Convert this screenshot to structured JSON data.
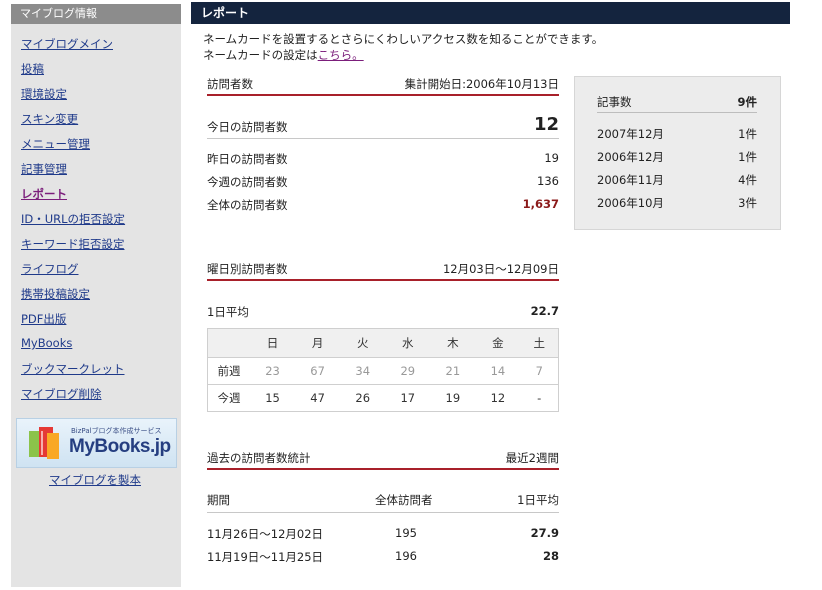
{
  "sidebar": {
    "title": "マイブログ情報",
    "items": [
      {
        "label": "マイブログメイン",
        "active": false
      },
      {
        "label": "投稿",
        "active": false
      },
      {
        "label": "環境設定",
        "active": false
      },
      {
        "label": "スキン変更",
        "active": false
      },
      {
        "label": "メニュー管理",
        "active": false
      },
      {
        "label": "記事管理",
        "active": false
      },
      {
        "label": "レポート",
        "active": true
      },
      {
        "label": "ID・URLの拒否設定",
        "active": false
      },
      {
        "label": "キーワード拒否設定",
        "active": false
      },
      {
        "label": "ライフログ",
        "active": false
      },
      {
        "label": "携帯投稿設定",
        "active": false
      },
      {
        "label": "PDF出版",
        "active": false
      },
      {
        "label": "MyBooks",
        "active": false
      },
      {
        "label": "ブックマークレット",
        "active": false
      },
      {
        "label": "マイブログ削除",
        "active": false
      }
    ],
    "banner": {
      "sub": "BizPalブログ本作成サービス",
      "logo": "MyBooks.jp"
    },
    "banner_link": "マイブログを製本"
  },
  "header": {
    "title": "レポート"
  },
  "intro": {
    "line1": "ネームカードを設置するとさらにくわしいアクセス数を知ることができます。",
    "line2_prefix": "ネームカードの設定は",
    "line2_link": "こちら。"
  },
  "visitors": {
    "heading": "訪問者数",
    "start_label": "集計開始日:2006年10月13日",
    "today_label": "今日の訪問者数",
    "today_value": "12",
    "yesterday_label": "昨日の訪問者数",
    "yesterday_value": "19",
    "week_label": "今週の訪問者数",
    "week_value": "136",
    "total_label": "全体の訪問者数",
    "total_value": "1,637"
  },
  "weekday": {
    "heading": "曜日別訪問者数",
    "range": "12月03日〜12月09日",
    "avg_label": "1日平均",
    "avg_value": "22.7",
    "days": [
      "日",
      "月",
      "火",
      "水",
      "木",
      "金",
      "土"
    ],
    "prev_label": "前週",
    "prev_values": [
      "23",
      "67",
      "34",
      "29",
      "21",
      "14",
      "7"
    ],
    "cur_label": "今週",
    "cur_values": [
      "15",
      "47",
      "26",
      "17",
      "19",
      "12",
      "-"
    ]
  },
  "history": {
    "heading": "過去の訪問者数統計",
    "range": "最近2週間",
    "col_period": "期間",
    "col_total": "全体訪問者",
    "col_avg": "1日平均",
    "rows": [
      {
        "period": "11月26日〜12月02日",
        "total": "195",
        "avg": "27.9"
      },
      {
        "period": "11月19日〜11月25日",
        "total": "196",
        "avg": "28"
      }
    ]
  },
  "articles": {
    "heading": "記事数",
    "total": "9件",
    "rows": [
      {
        "month": "2007年12月",
        "count": "1件"
      },
      {
        "month": "2006年12月",
        "count": "1件"
      },
      {
        "month": "2006年11月",
        "count": "4件"
      },
      {
        "month": "2006年10月",
        "count": "3件"
      }
    ]
  },
  "colors": {
    "accent_red": "#a8202a",
    "header_bg": "#14243e",
    "link": "#1f3a8a",
    "total_value": "#8b1a1a"
  }
}
